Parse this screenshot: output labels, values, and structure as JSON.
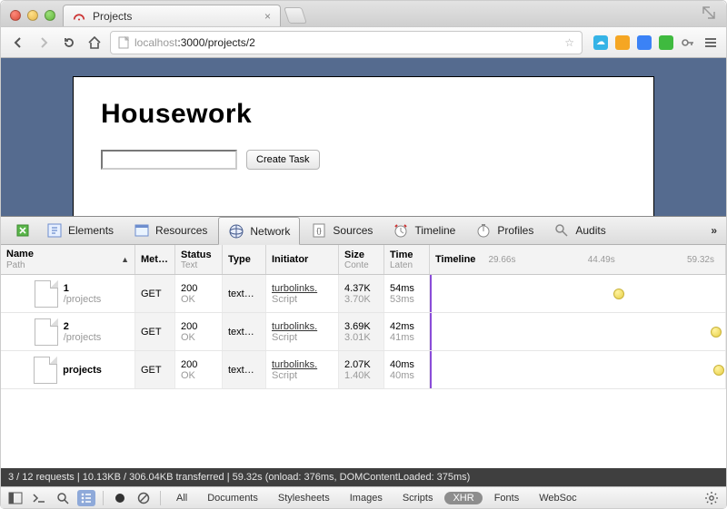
{
  "window": {
    "title": "Projects"
  },
  "toolbar": {
    "url_full": "localhost:3000/projects/2",
    "url_gray": "localhost",
    "url_rest": ":3000/projects/2"
  },
  "page": {
    "heading": "Housework",
    "create_label": "Create Task",
    "task_value": ""
  },
  "devtools": {
    "tabs": [
      "Elements",
      "Resources",
      "Network",
      "Sources",
      "Timeline",
      "Profiles",
      "Audits"
    ],
    "active_tab": "Network"
  },
  "network": {
    "columns": {
      "name": "Name",
      "name_sub": "Path",
      "method": "Met…",
      "status": "Status",
      "status_sub": "Text",
      "type": "Type",
      "initiator": "Initiator",
      "size": "Size",
      "size_sub": "Conte",
      "time": "Time",
      "time_sub": "Laten",
      "timeline": "Timeline"
    },
    "ticks": [
      "29.66s",
      "44.49s",
      "59.32s"
    ],
    "rows": [
      {
        "name": "1",
        "path": "/projects",
        "method": "GET",
        "status_code": "200",
        "status_text": "OK",
        "type": "text…",
        "initiator": "turbolinks.",
        "initiator_sub": "Script",
        "size": "4.37K",
        "size_sub": "3.70K",
        "time": "54ms",
        "time_sub": "53ms",
        "dot_pct": 62
      },
      {
        "name": "2",
        "path": "/projects",
        "method": "GET",
        "status_code": "200",
        "status_text": "OK",
        "type": "text…",
        "initiator": "turbolinks.",
        "initiator_sub": "Script",
        "size": "3.69K",
        "size_sub": "3.01K",
        "time": "42ms",
        "time_sub": "41ms",
        "dot_pct": 95
      },
      {
        "name": "projects",
        "path": "",
        "method": "GET",
        "status_code": "200",
        "status_text": "OK",
        "type": "text…",
        "initiator": "turbolinks.",
        "initiator_sub": "Script",
        "size": "2.07K",
        "size_sub": "1.40K",
        "time": "40ms",
        "time_sub": "40ms",
        "dot_pct": 96
      }
    ]
  },
  "status": "3 / 12 requests  |  10.13KB / 306.04KB transferred  |  59.32s (onload: 376ms, DOMContentLoaded: 375ms)",
  "filters": {
    "labels": [
      "All",
      "Documents",
      "Stylesheets",
      "Images",
      "Scripts",
      "XHR",
      "Fonts",
      "WebSoc"
    ],
    "active": "XHR"
  }
}
